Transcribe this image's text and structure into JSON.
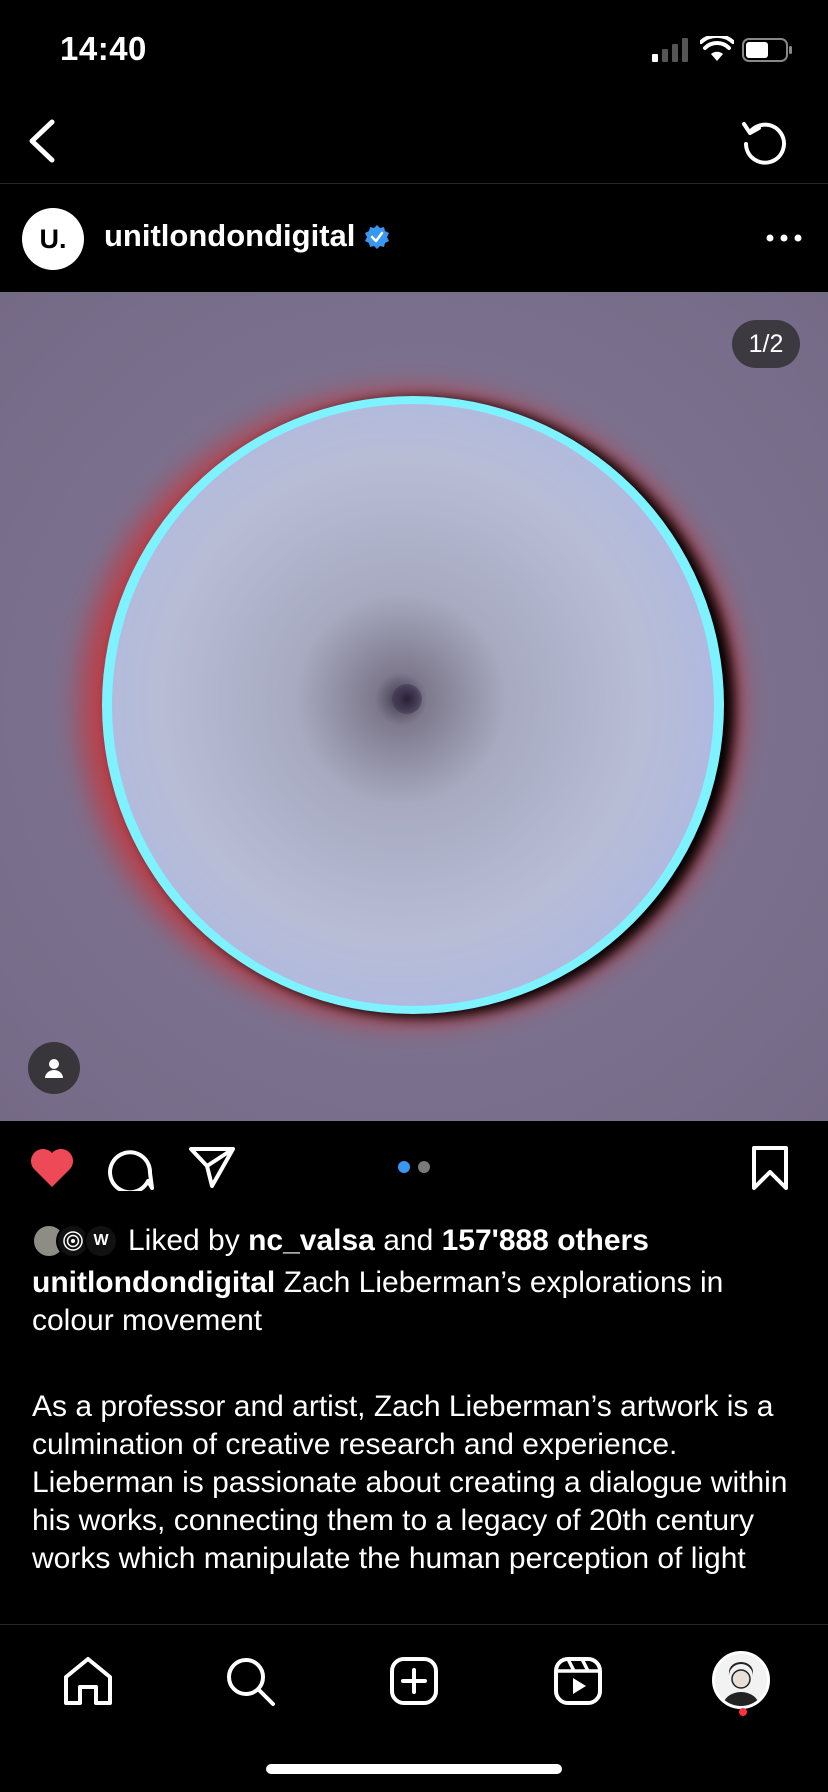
{
  "status_bar": {
    "time": "14:40"
  },
  "post": {
    "avatar_letter": "U.",
    "username": "unitlondondigital",
    "verified": true,
    "media_counter": "1/2",
    "carousel": {
      "total": 2,
      "current": 1
    },
    "liked": true
  },
  "likes": {
    "prefix": "Liked by",
    "user": "nc_valsa",
    "conjunction": "and",
    "others": "157'888 others",
    "mini_avatar_3_letter": "W"
  },
  "caption": {
    "username": "unitlondondigital",
    "headline": "Zach Lieberman’s explorations in colour movement",
    "body": "As a professor and artist, Zach Lieberman’s artwork is a culmination of creative research and experience. Lieberman is passionate about creating a dialogue within his works, connecting them to a legacy of 20th century works which manipulate the human perception of light"
  },
  "colors": {
    "accent": "#3897f0",
    "like_red": "#ed4956",
    "notification_red": "#ff3040"
  },
  "icons": {
    "back": "back-chevron-icon",
    "refresh": "refresh-icon",
    "more": "more-icon",
    "verified": "verified-badge-icon",
    "like": "heart-icon",
    "comment": "comment-icon",
    "share": "share-icon",
    "save": "bookmark-icon",
    "tag": "user-tag-icon",
    "home": "home-icon",
    "search": "search-icon",
    "create": "create-icon",
    "reels": "reels-icon",
    "profile": "profile-avatar"
  }
}
